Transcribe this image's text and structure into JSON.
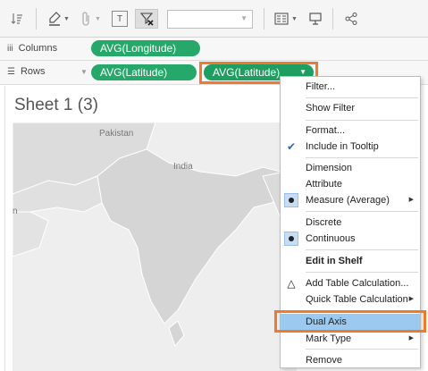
{
  "toolbar": {
    "text_icon_label": "T"
  },
  "shelves": {
    "columns_label": "Columns",
    "rows_label": "Rows",
    "columns_pill": "AVG(Longitude)",
    "rows_pill_1": "AVG(Latitude)",
    "rows_pill_2": "AVG(Latitude)"
  },
  "sheet": {
    "title": "Sheet 1 (3)"
  },
  "map": {
    "label_pakistan": "Pakistan",
    "label_india": "India",
    "label_edge": "n"
  },
  "menu": {
    "filter": "Filter...",
    "show_filter": "Show Filter",
    "format": "Format...",
    "include_tooltip": "Include in Tooltip",
    "dimension": "Dimension",
    "attribute": "Attribute",
    "measure": "Measure (Average)",
    "discrete": "Discrete",
    "continuous": "Continuous",
    "edit_shelf": "Edit in Shelf",
    "add_table_calc": "Add Table Calculation...",
    "quick_table_calc": "Quick Table Calculation",
    "dual_axis": "Dual Axis",
    "mark_type": "Mark Type",
    "remove": "Remove"
  },
  "colors": {
    "pill_green": "#25a86a",
    "highlight_orange": "#ec7b2e",
    "menu_hover_blue": "#9cc9ef"
  }
}
